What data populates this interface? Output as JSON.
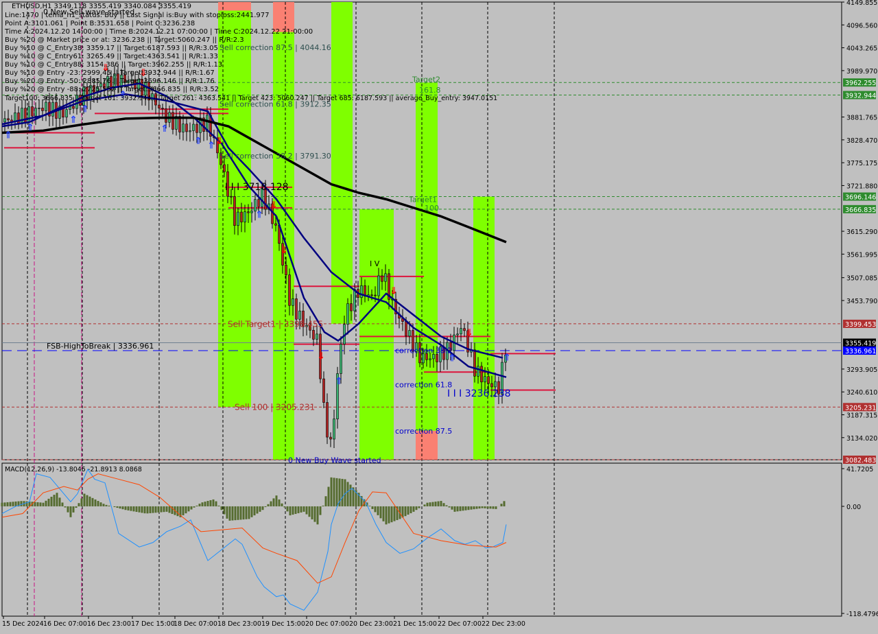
{
  "header": {
    "symbol_line": "ETHUSD,H1  3349.118 3355.419 3340.084 3355.419",
    "wave_label": "0 New Sell wave started",
    "info_lines": [
      "Line:1470 | tema_h1_status: Buy || Last Signal is:Buy with stoploss:2441.977",
      "Point A:3101.061 | Point B:3531.658 | Point C:3236.238",
      "Time A:2024.12.20 14:00:00 | Time B:2024.12.21 07:00:00 | Time C:2024.12.22 21:00:00",
      "Buy %20 @ Market price or at: 3236.238 || Target:5060.247 || R/R:2.3",
      "Buy %10 @ C_Entry38: 3359.17 || Target:6187.593 || R/R:3.05",
      "Buy %10 @ C_Entry61: 3265.49 || Target:4363.541 || R/R:1.33",
      "Buy %10 @ C_Entry88: 3154.386 || Target:3962.255 || R/R:1.13",
      "Buy %10 @ Entry -23: 2999.45 || Target:3932.944 || R/R:1.67",
      "Buy %20 @ Entry -50: 2885.76 || Target:3696.146 || R/R:1.76",
      "Buy %20 @ Entry -88: 2725.552 || Target:3666.835 || R/R:3.52"
    ],
    "targets_line": "Target100: 3666.835 || Target 161: 3932.944 || Target 261: 4363.541 || Target 423: 5060.247 || Target 685: 6187.593 || average_Buy_entry: 3947.0151"
  },
  "chart_data": [
    {
      "type": "candlestick",
      "title": "ETHUSD,H1",
      "ohlc_last": {
        "open": 3349.118,
        "high": 3355.419,
        "low": 3340.084,
        "close": 3355.419
      },
      "ylim": [
        3082.483,
        4149.855
      ],
      "y_ticks": [
        4149.855,
        4096.56,
        4043.265,
        3989.97,
        3881.765,
        3828.47,
        3775.175,
        3721.88,
        3615.29,
        3561.995,
        3507.085,
        3453.79,
        3293.905,
        3240.61,
        3187.315,
        3134.02
      ],
      "x_ticks": [
        "15 Dec 2024",
        "16 Dec 07:00",
        "16 Dec 23:00",
        "17 Dec 15:00",
        "18 Dec 07:00",
        "18 Dec 23:00",
        "19 Dec 15:00",
        "20 Dec 07:00",
        "20 Dec 23:00",
        "21 Dec 15:00",
        "22 Dec 07:00",
        "22 Dec 23:00"
      ],
      "price_labels": [
        {
          "value": 3962.255,
          "color": "#2e8b2e",
          "style": "dashed"
        },
        {
          "value": 3932.944,
          "color": "#2e8b2e",
          "style": "dashed"
        },
        {
          "value": 3696.146,
          "color": "#2e8b2e",
          "style": "dashed"
        },
        {
          "value": 3666.835,
          "color": "#2e8b2e",
          "style": "dashed"
        },
        {
          "value": 3399.453,
          "color": "#b03030",
          "style": "dashed"
        },
        {
          "value": 3355.419,
          "color": "#000000",
          "style": "solid"
        },
        {
          "value": 3336.961,
          "color": "#0000ff",
          "style": "longdash"
        },
        {
          "value": 3205.231,
          "color": "#b03030",
          "style": "dashed"
        },
        {
          "value": 3082.483,
          "color": "#b03030",
          "style": "dashed"
        }
      ],
      "annotations": [
        {
          "text": "Sell correction 87.5 | 4044.16",
          "price": 4044.16,
          "color": "#2f4f4f"
        },
        {
          "text": "Sell correction 61.8 | 3912.35",
          "price": 3912.35,
          "color": "#2f4f4f"
        },
        {
          "text": "Sell correction 38.2 | 3791.30",
          "price": 3791.3,
          "color": "#2f4f4f"
        },
        {
          "text": "I I I 3718.128",
          "price": 3718.128,
          "color": "#000000"
        },
        {
          "text": "Sell Target1 | 3398.455",
          "price": 3398.455,
          "color": "#b03030"
        },
        {
          "text": "Sell 100 | 3205.231",
          "price": 3205.231,
          "color": "#b03030"
        },
        {
          "text": "FSB-HighToBreak | 3336.961",
          "price": 3336.961,
          "color": "#000000"
        },
        {
          "text": "Target2",
          "price": 3970,
          "color": "#2e8b2e"
        },
        {
          "text": "161.8",
          "price": 3945,
          "color": "#2e8b2e"
        },
        {
          "text": "Target1",
          "price": 3690,
          "color": "#2e8b2e"
        },
        {
          "text": "100",
          "price": 3670,
          "color": "#2e8b2e"
        },
        {
          "text": "correction 38.2",
          "price": 3338,
          "color": "#0000cc"
        },
        {
          "text": "correction 61.8",
          "price": 3258,
          "color": "#0000cc"
        },
        {
          "text": "correction 87.5",
          "price": 3150,
          "color": "#0000cc"
        },
        {
          "text": "I I I 3236.238",
          "price": 3236.238,
          "color": "#0000cc"
        },
        {
          "text": "I V",
          "price": 3540,
          "color": "#000000"
        },
        {
          "text": "0 New Buy Wave started",
          "price": 3082,
          "color": "#0000cc"
        }
      ],
      "zones": [
        {
          "from_bar": 315,
          "to_bar": 363,
          "ymin": 3205.231,
          "ymax": 4149.855,
          "color": "#7fff00"
        },
        {
          "from_bar": 315,
          "to_bar": 363,
          "ymin": 4130,
          "ymax": 4149.855,
          "color": "#fa8072"
        },
        {
          "from_bar": 395,
          "to_bar": 426,
          "ymin": 3082.483,
          "ymax": 4149.855,
          "color": "#7fff00"
        },
        {
          "from_bar": 395,
          "to_bar": 426,
          "ymin": 4080,
          "ymax": 4149.855,
          "color": "#fa8072"
        },
        {
          "from_bar": 480,
          "to_bar": 511,
          "ymin": 3399.453,
          "ymax": 4149.855,
          "color": "#7fff00"
        },
        {
          "from_bar": 521,
          "to_bar": 571,
          "ymin": 3082.483,
          "ymax": 3666.835,
          "color": "#7fff00"
        },
        {
          "from_bar": 603,
          "to_bar": 635,
          "ymin": 3150,
          "ymax": 3962.255,
          "color": "#7fff00"
        },
        {
          "from_bar": 603,
          "to_bar": 635,
          "ymin": 3082.483,
          "ymax": 3150,
          "color": "#fa8072"
        },
        {
          "from_bar": 687,
          "to_bar": 718,
          "ymin": 3082.483,
          "ymax": 3696.146,
          "color": "#7fff00"
        }
      ],
      "series": [
        {
          "name": "close",
          "color": "#000000",
          "x": [
            0,
            30,
            60,
            90,
            120,
            150,
            180,
            210,
            240,
            270,
            300,
            320,
            340,
            360,
            380,
            400,
            420,
            440,
            460,
            470,
            480,
            490,
            500,
            520,
            540,
            555,
            570,
            590,
            610,
            630,
            650,
            670,
            690,
            710,
            725,
            735
          ],
          "values": [
            3870,
            3885,
            3905,
            3890,
            3935,
            3960,
            3970,
            3945,
            3880,
            3850,
            3870,
            3770,
            3640,
            3660,
            3700,
            3620,
            3450,
            3400,
            3360,
            3180,
            3110,
            3300,
            3420,
            3480,
            3460,
            3520,
            3440,
            3380,
            3320,
            3320,
            3340,
            3395,
            3290,
            3260,
            3250,
            3355
          ]
        },
        {
          "name": "ma-fast",
          "color": "#000080",
          "x": [
            0,
            40,
            80,
            120,
            160,
            200,
            240,
            280,
            320,
            360,
            400,
            440,
            470,
            490,
            520,
            560,
            600,
            640,
            680,
            730
          ],
          "values": [
            3860,
            3870,
            3900,
            3930,
            3950,
            3960,
            3930,
            3880,
            3820,
            3720,
            3650,
            3460,
            3380,
            3360,
            3400,
            3470,
            3420,
            3370,
            3340,
            3320
          ]
        },
        {
          "name": "ma-mid",
          "color": "#000080",
          "x": [
            0,
            60,
            120,
            180,
            240,
            300,
            330,
            360,
            400,
            440,
            480,
            520,
            560,
            600,
            640,
            680,
            735
          ],
          "values": [
            3865,
            3885,
            3920,
            3935,
            3920,
            3895,
            3810,
            3760,
            3690,
            3600,
            3520,
            3470,
            3450,
            3390,
            3350,
            3300,
            3275
          ]
        },
        {
          "name": "ma-slow",
          "color": "#000000",
          "x": [
            0,
            60,
            120,
            180,
            230,
            280,
            330,
            380,
            430,
            480,
            520,
            560,
            600,
            640,
            680,
            735
          ],
          "values": [
            3845,
            3850,
            3865,
            3878,
            3880,
            3880,
            3860,
            3815,
            3770,
            3725,
            3705,
            3690,
            3670,
            3650,
            3625,
            3590
          ]
        }
      ],
      "signals": {
        "buy_arrows": [
          8,
          40,
          103,
          120,
          175,
          236,
          285,
          304,
          374,
          490,
          655,
          735
        ],
        "sell_arrows": [
          150,
          205,
          316,
          395,
          410,
          464,
          570,
          680
        ]
      }
    },
    {
      "type": "line",
      "title": "MACD(12,26,9) -13.8045 -21.8913 8.0868",
      "ylim": [
        -118.4796,
        41.7205
      ],
      "y_ticks": [
        41.7205,
        0.0,
        -118.4796
      ],
      "series": [
        {
          "name": "MACD",
          "color": "#1e90ff",
          "x": [
            0,
            20,
            40,
            50,
            70,
            100,
            110,
            125,
            135,
            150,
            170,
            200,
            220,
            240,
            260,
            275,
            300,
            315,
            340,
            350,
            372,
            382,
            400,
            410,
            420,
            440,
            460,
            475,
            480,
            490,
            500,
            510,
            530,
            545,
            560,
            580,
            600,
            620,
            640,
            660,
            675,
            690,
            705,
            715,
            730,
            735
          ],
          "values": [
            -8,
            0,
            5,
            36,
            32,
            5,
            14,
            41,
            30,
            26,
            -30,
            -45,
            -40,
            -28,
            -22,
            -15,
            -60,
            -51,
            -36,
            -42,
            -78,
            -89,
            -100,
            -98,
            -108,
            -115,
            -95,
            -50,
            -20,
            3,
            14,
            20,
            5,
            -20,
            -40,
            -52,
            -47,
            -35,
            -25,
            -38,
            -42,
            -38,
            -46,
            -45,
            -40,
            -20
          ]
        },
        {
          "name": "Signal",
          "color": "#ff4500",
          "x": [
            0,
            30,
            60,
            90,
            110,
            125,
            140,
            170,
            200,
            230,
            260,
            290,
            320,
            350,
            380,
            400,
            430,
            460,
            480,
            500,
            520,
            540,
            560,
            600,
            640,
            680,
            720,
            735
          ],
          "values": [
            -12,
            -8,
            15,
            22,
            18,
            30,
            36,
            30,
            24,
            10,
            -10,
            -28,
            -26,
            -24,
            -46,
            -52,
            -60,
            -85,
            -78,
            -40,
            -5,
            16,
            15,
            -30,
            -38,
            -43,
            -45,
            -40
          ]
        },
        {
          "name": "Histogram",
          "color": "#556b2f",
          "x": [
            0,
            30,
            60,
            80,
            100,
            120,
            135,
            150,
            180,
            210,
            240,
            260,
            290,
            310,
            330,
            360,
            380,
            400,
            420,
            440,
            460,
            480,
            500,
            520,
            540,
            560,
            580,
            600,
            620,
            640,
            660,
            680,
            700,
            720,
            735
          ],
          "values": [
            4,
            6,
            4,
            15,
            -12,
            14,
            8,
            2,
            -4,
            -8,
            -6,
            -12,
            4,
            8,
            -16,
            -14,
            -4,
            12,
            -10,
            -6,
            -20,
            32,
            30,
            15,
            -3,
            -20,
            -14,
            -6,
            4,
            6,
            -6,
            -4,
            -2,
            -3,
            8
          ]
        }
      ]
    }
  ]
}
